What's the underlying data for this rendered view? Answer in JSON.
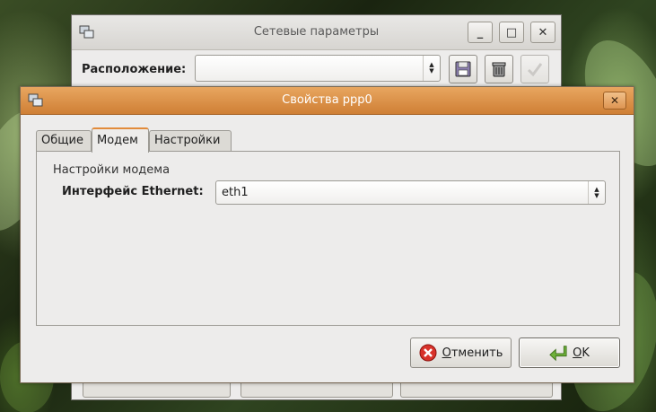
{
  "back_window": {
    "title": "Сетевые параметры",
    "location_label": "Расположение:",
    "location_value": "",
    "min_label": "_",
    "max_label": "□",
    "close_label": "✕"
  },
  "dialog": {
    "title": "Свойства ppp0",
    "close_label": "✕",
    "tabs": [
      {
        "label": "Общие"
      },
      {
        "label": "Модем"
      },
      {
        "label": "Настройки"
      }
    ],
    "section_title": "Настройки модема",
    "ethernet_label": "Интерфейс Ethernet:",
    "ethernet_value": "eth1",
    "cancel": {
      "mnemonic": "О",
      "rest": "тменить"
    },
    "ok": {
      "mnemonic": "O",
      "rest": "K"
    }
  },
  "colors": {
    "title_active": "#cf7f35",
    "cancel_icon": "#d8322a",
    "ok_icon": "#6fb23a"
  }
}
